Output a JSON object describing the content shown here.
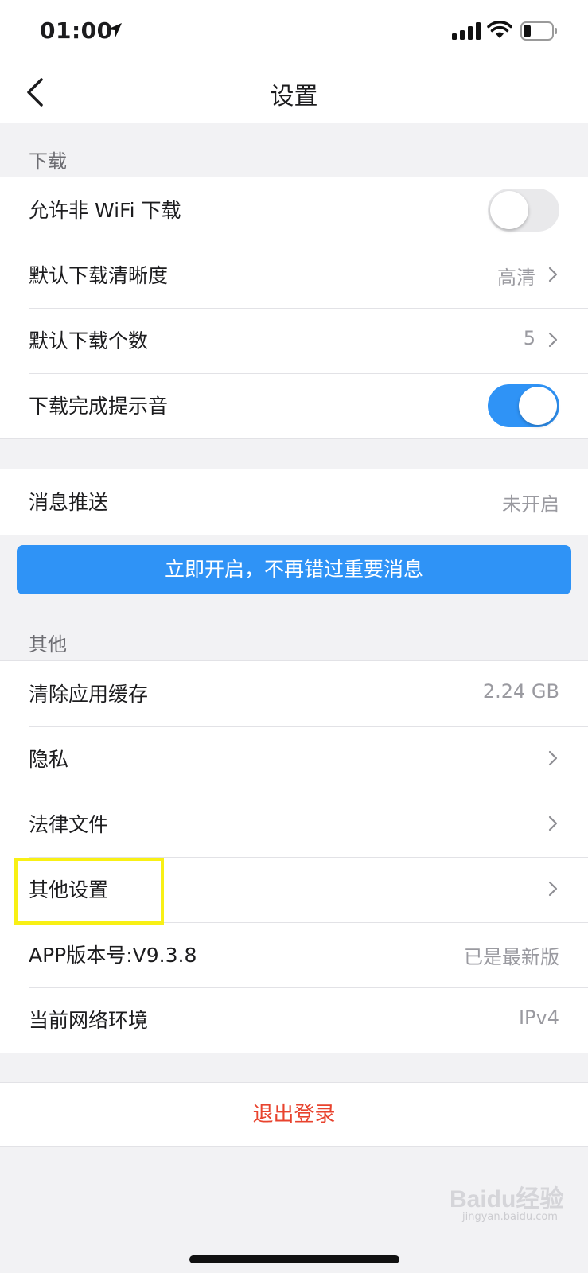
{
  "status_bar": {
    "time": "01:00",
    "icons": [
      "location-arrow-icon",
      "signal-icon",
      "wifi-icon",
      "battery-icon"
    ]
  },
  "nav": {
    "title": "设置",
    "back_icon": "chevron-left-icon"
  },
  "download": {
    "header": "下载",
    "rows": [
      {
        "label": "允许非 WiFi 下载",
        "toggle": false
      },
      {
        "label": "默认下载清晰度",
        "value": "高清"
      },
      {
        "label": "默认下载个数",
        "value": "5"
      },
      {
        "label": "下载完成提示音",
        "toggle": true
      }
    ]
  },
  "push": {
    "label": "消息推送",
    "value": "未开启",
    "cta": "立即开启，不再错过重要消息"
  },
  "other": {
    "header": "其他",
    "rows": [
      {
        "label": "清除应用缓存",
        "value": "2.24 GB"
      },
      {
        "label": "隐私"
      },
      {
        "label": "法律文件"
      },
      {
        "label": "其他设置"
      },
      {
        "label": "APP版本号:V9.3.8",
        "value": "已是最新版"
      },
      {
        "label": "当前网络环境",
        "value": "IPv4"
      }
    ]
  },
  "logout": "退出登录",
  "watermark": {
    "logo": "Baidu经验",
    "sub": "jingyan.baidu.com"
  },
  "colors": {
    "accent": "#2f93f6",
    "destructive": "#e8432e",
    "highlight": "#f8f015",
    "background": "#f2f2f4"
  }
}
